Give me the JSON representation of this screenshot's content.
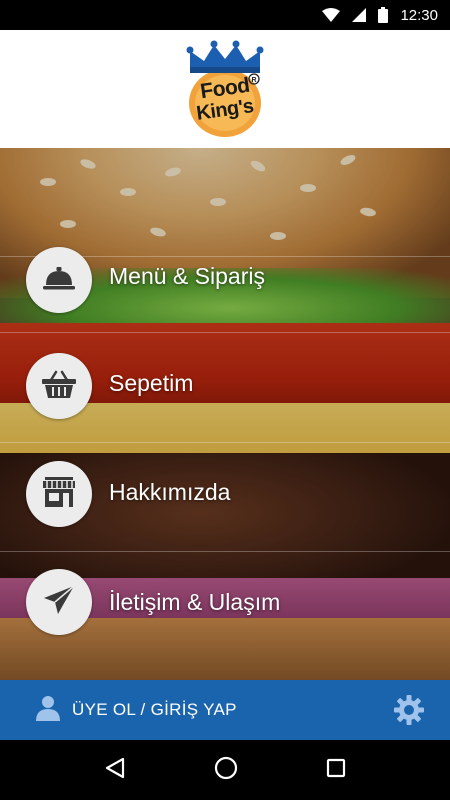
{
  "status_bar": {
    "time": "12:30",
    "icons": [
      "wifi-icon",
      "signal-icon",
      "battery-icon"
    ]
  },
  "header": {
    "logo_text_line1": "Food",
    "logo_text_line2": "King's",
    "logo_icon": "crown-icon"
  },
  "menu": {
    "items": [
      {
        "label": "Menü & Sipariş",
        "icon": "cloche-icon"
      },
      {
        "label": "Sepetim",
        "icon": "basket-icon"
      },
      {
        "label": "Hakkımızda",
        "icon": "store-icon"
      },
      {
        "label": "İletişim & Ulaşım",
        "icon": "paper-plane-icon"
      }
    ]
  },
  "login_bar": {
    "label": "ÜYE OL / GİRİŞ YAP",
    "user_icon": "user-icon",
    "settings_icon": "gear-icon"
  },
  "nav_bar": {
    "buttons": [
      "back-icon",
      "home-icon",
      "recents-icon"
    ]
  },
  "colors": {
    "accent_blue": "#1a63ad",
    "crown_blue": "#1c5fb0",
    "logo_orange": "#f2a23a",
    "circle_bg": "#ececec",
    "icon_dark": "#3a3a3a"
  }
}
